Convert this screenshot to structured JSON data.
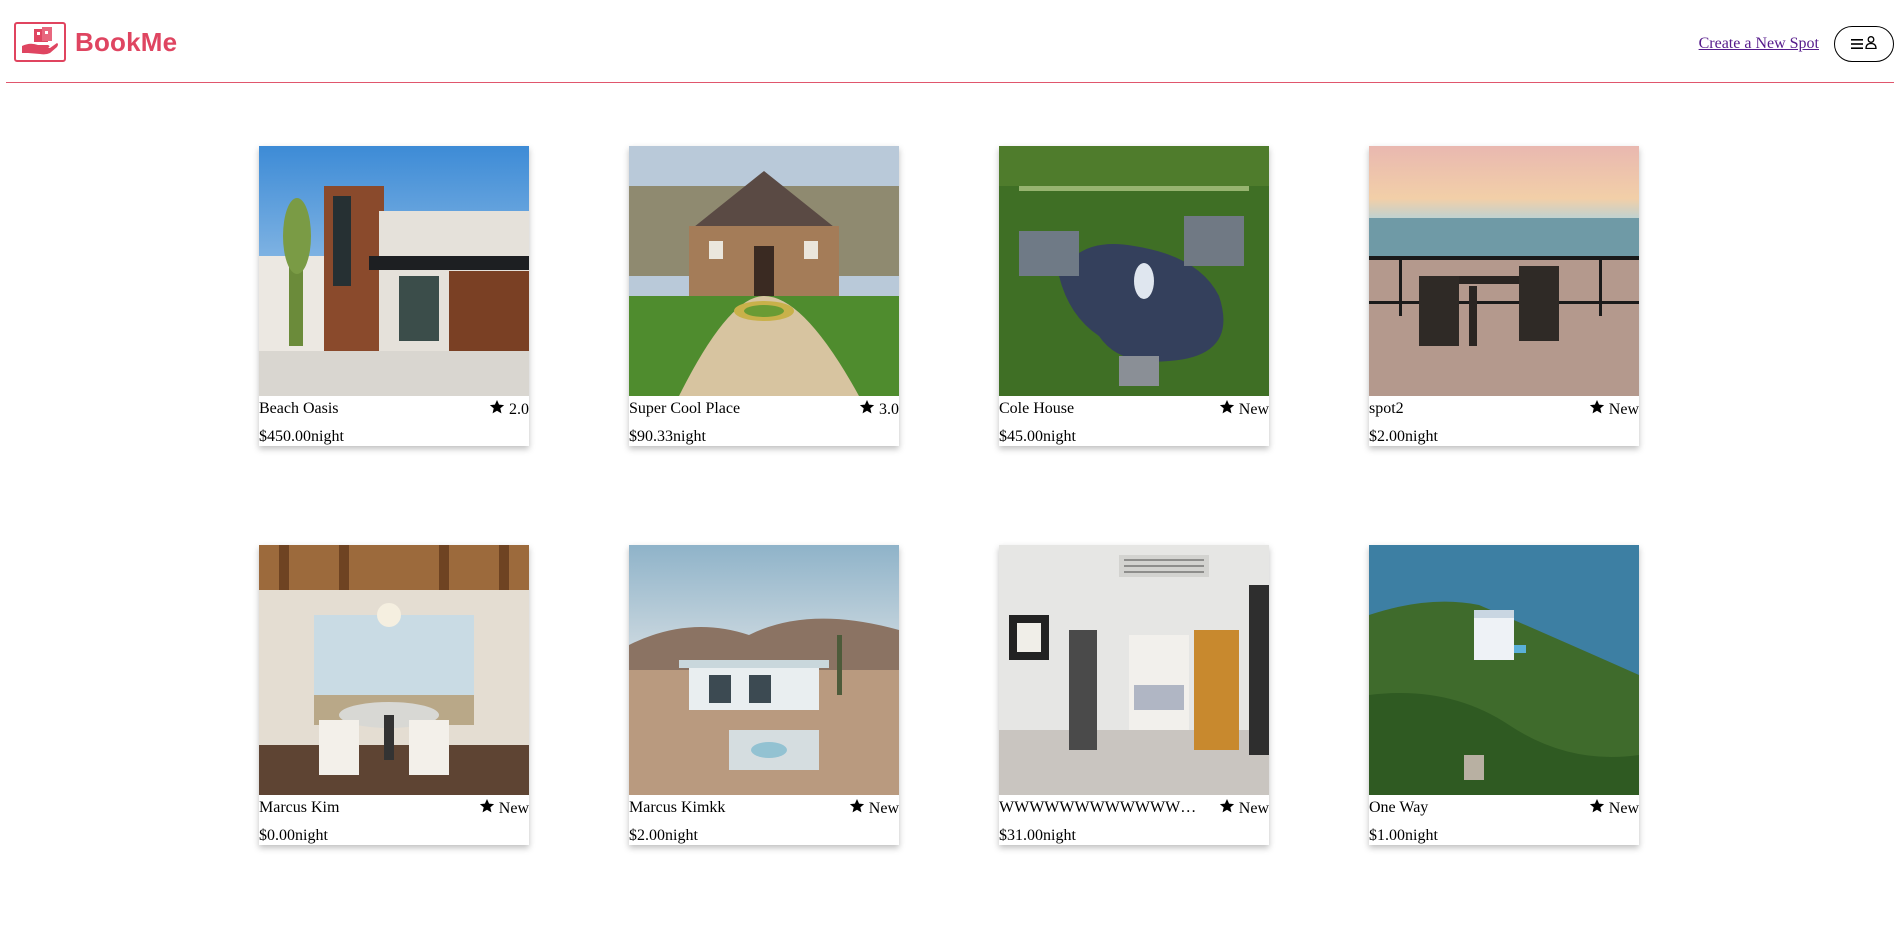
{
  "header": {
    "brand": "BookMe",
    "create_spot_label": "Create a New Spot",
    "menu_icon": "hamburger-icon",
    "user_icon": "user-icon",
    "accent_color": "#df4561"
  },
  "spots": [
    {
      "name": "Beach Oasis",
      "rating": "2.0",
      "price": "$450.00",
      "unit": "night",
      "image": "modern-house-photo"
    },
    {
      "name": "Super Cool Place",
      "rating": "3.0",
      "price": "$90.33",
      "unit": "night",
      "image": "stone-mansion-photo"
    },
    {
      "name": "Cole House",
      "rating": "New",
      "price": "$45.00",
      "unit": "night",
      "image": "estate-lake-aerial-photo"
    },
    {
      "name": "spot2",
      "rating": "New",
      "price": "$2.00",
      "unit": "night",
      "image": "ocean-balcony-photo"
    },
    {
      "name": "Marcus Kim",
      "rating": "New",
      "price": "$0.00",
      "unit": "night",
      "image": "dining-room-photo"
    },
    {
      "name": "Marcus Kimkk",
      "rating": "New",
      "price": "$2.00",
      "unit": "night",
      "image": "desert-house-photo"
    },
    {
      "name": "WWWWWWWWWWWWW...",
      "rating": "New",
      "price": "$31.00",
      "unit": "night",
      "image": "hallway-interior-photo"
    },
    {
      "name": "One Way",
      "rating": "New",
      "price": "$1.00",
      "unit": "night",
      "image": "island-house-aerial-photo"
    }
  ]
}
